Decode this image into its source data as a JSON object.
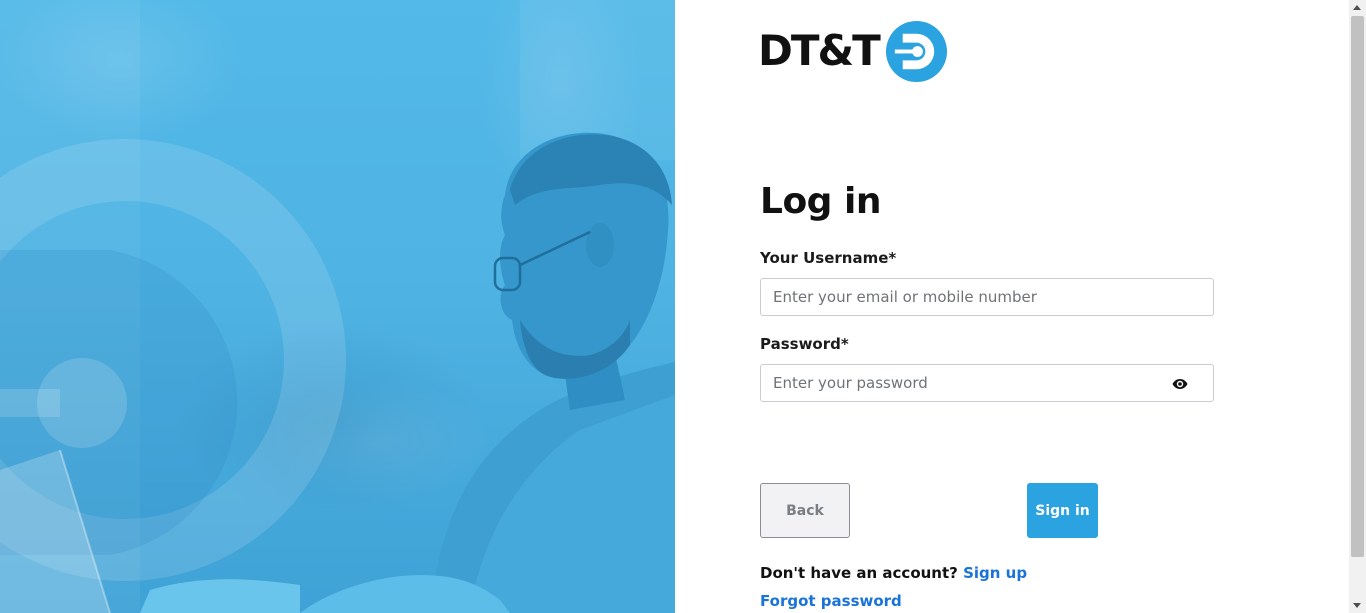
{
  "brand": {
    "name": "DT&T",
    "accent": "#2aa3e0",
    "logo_icon": "dt-circle-icon"
  },
  "hero": {
    "image": "man-with-glasses-at-laptop",
    "overlay_color": "#4fb3e3"
  },
  "form": {
    "title": "Log in",
    "username_label": "Your Username*",
    "username_placeholder": "Enter your email or mobile number",
    "username_value": "",
    "password_label": "Password*",
    "password_placeholder": "Enter your password",
    "password_value": "",
    "toggle_icon": "eye-icon"
  },
  "buttons": {
    "back": "Back",
    "signin": "Sign in"
  },
  "footer": {
    "no_account_text": "Don't have an account?",
    "signup_link": "Sign up",
    "forgot_link": "Forgot password"
  }
}
